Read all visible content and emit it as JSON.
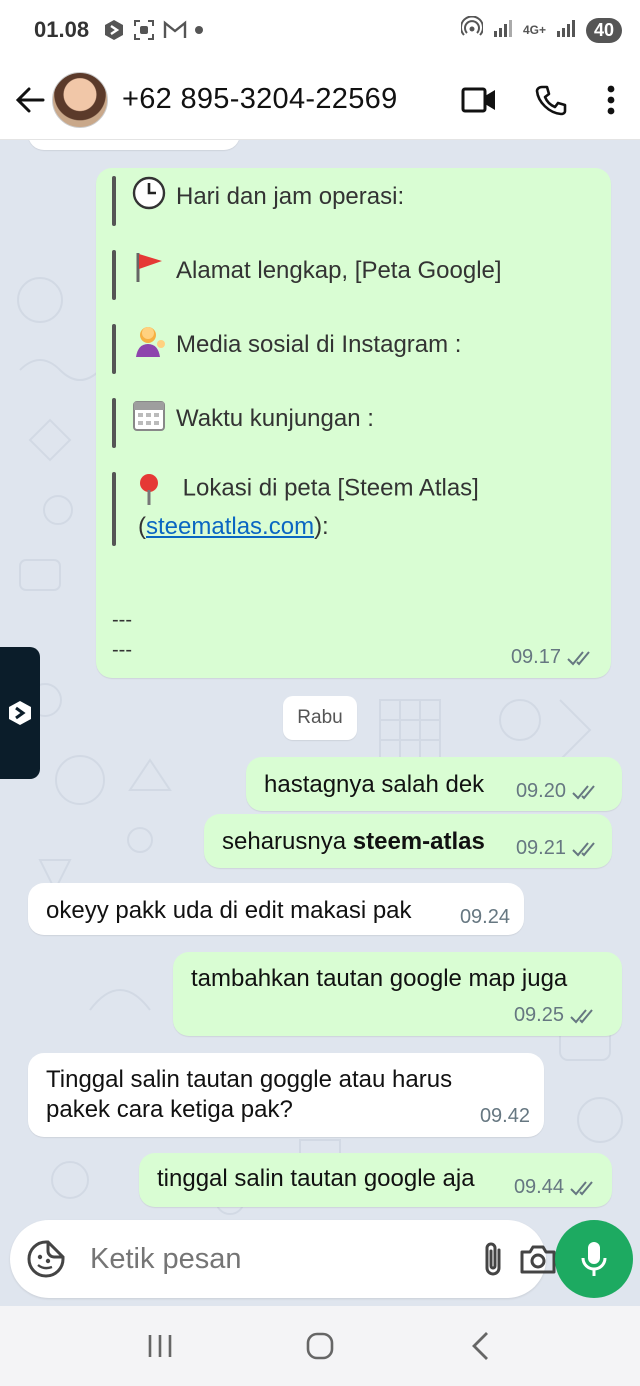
{
  "status_bar": {
    "time": "01.08",
    "network_label": "4G+",
    "battery": "40"
  },
  "header": {
    "contact": "+62 895-3204-22569",
    "icons": [
      "back-arrow-icon",
      "avatar",
      "video-call-icon",
      "phone-icon",
      "more-vert-icon"
    ]
  },
  "big_message": {
    "lines": [
      {
        "emoji": "clock-emoji",
        "text": "Hari dan jam operasi:"
      },
      {
        "emoji": "red-flag-emoji",
        "text": "Alamat lengkap, [Peta Google]"
      },
      {
        "emoji": "person-tipping-hand-emoji",
        "text": "Media sosial di Instagram :"
      },
      {
        "emoji": "calendar-emoji",
        "text": "Waktu kunjungan :"
      },
      {
        "emoji": "round-pushpin-emoji",
        "text": "Lokasi di peta [Steem Atlas]"
      }
    ],
    "link_prefix": "(",
    "link_text": "steematlas.com",
    "link_suffix": "):",
    "separator1": "---",
    "separator2": "---",
    "time": "09.17"
  },
  "day_label": "Rabu",
  "messages": [
    {
      "dir": "out",
      "text": "hastagnya salah dek",
      "time": "09.20"
    },
    {
      "dir": "out",
      "text_prefix": "seharusnya ",
      "text_bold": "steem-atlas",
      "time": "09.21"
    },
    {
      "dir": "in",
      "text": "okeyy pakk uda di edit makasi pak",
      "time": "09.24"
    },
    {
      "dir": "out",
      "text": "tambahkan tautan google map juga",
      "time": "09.25"
    },
    {
      "dir": "in",
      "text_line1": "Tinggal salin tautan goggle atau harus",
      "text_line2": "pakek cara ketiga pak?",
      "time": "09.42"
    },
    {
      "dir": "out",
      "text": "tinggal salin tautan google aja",
      "time": "09.44"
    }
  ],
  "input": {
    "placeholder": "Ketik pesan"
  },
  "colors": {
    "outgoing_bubble": "#d9fdd3",
    "incoming_bubble": "#ffffff",
    "accent_green": "#1daa61",
    "chat_background": "#dfe5ee",
    "link": "#0a66c2"
  }
}
